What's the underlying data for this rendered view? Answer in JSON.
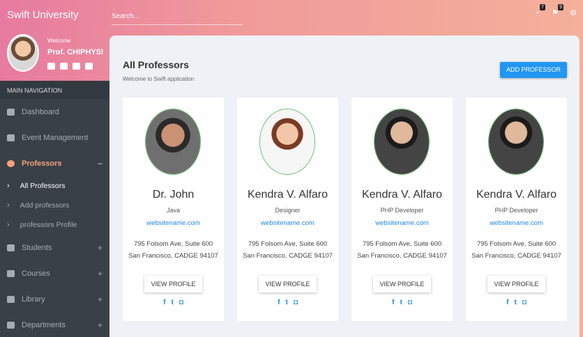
{
  "app": {
    "brand": "Swift University"
  },
  "topbar": {
    "search_placeholder": "Search...",
    "notifications_count": "7",
    "messages_count": "9"
  },
  "user": {
    "welcome": "Welcome",
    "name": "Prof. CHIPHYSI"
  },
  "nav": {
    "heading": "MAIN NAVIGATION",
    "items": [
      {
        "label": "Dashboard",
        "icon": "home-icon",
        "toggle": ""
      },
      {
        "label": "Event Management",
        "icon": "calendar-icon",
        "toggle": ""
      },
      {
        "label": "Professors",
        "icon": "user-icon",
        "toggle": "−"
      }
    ],
    "sub_items": [
      {
        "label": "All Professors"
      },
      {
        "label": "Add professors"
      },
      {
        "label": "professors Profile"
      }
    ],
    "more_items": [
      {
        "label": "Students",
        "icon": "users-icon",
        "toggle": "+"
      },
      {
        "label": "Courses",
        "icon": "graduation-cap-icon",
        "toggle": "+"
      },
      {
        "label": "Library",
        "icon": "book-icon",
        "toggle": "+"
      },
      {
        "label": "Departments",
        "icon": "building-icon",
        "toggle": "+"
      }
    ]
  },
  "page": {
    "title": "All Professors",
    "subtitle": "Welcome to Swift application",
    "add_button": "ADD PROFESSOR"
  },
  "cards": [
    {
      "name": "Dr. John",
      "role": "Java",
      "website": "websitename.com",
      "address1": "795 Folsom Ave, Suite 600",
      "address2": "San Francisco, CADGE 94107",
      "button": "VIEW PROFILE"
    },
    {
      "name": "Kendra V. Alfaro",
      "role": "Designer",
      "website": "websitename.com",
      "address1": "795 Folsom Ave, Suite 600",
      "address2": "San Francisco, CADGE 94107",
      "button": "VIEW PROFILE"
    },
    {
      "name": "Kendra V. Alfaro",
      "role": "PHP Developer",
      "website": "websitename.com",
      "address1": "795 Folsom Ave, Suite 600",
      "address2": "San Francisco, CADGE 94107",
      "button": "VIEW PROFILE"
    },
    {
      "name": "Kendra V. Alfaro",
      "role": "PHP Developer",
      "website": "websitename.com",
      "address1": "795 Folsom Ave, Suite 600",
      "address2": "San Francisco, CADGE 94107",
      "button": "VIEW PROFILE"
    }
  ],
  "social": {
    "facebook": "f",
    "twitter": "t",
    "instagram": "◘"
  },
  "colors": {
    "accent": "#2196f3",
    "active_nav": "#f4a27c",
    "sidebar": "#3a4047"
  }
}
